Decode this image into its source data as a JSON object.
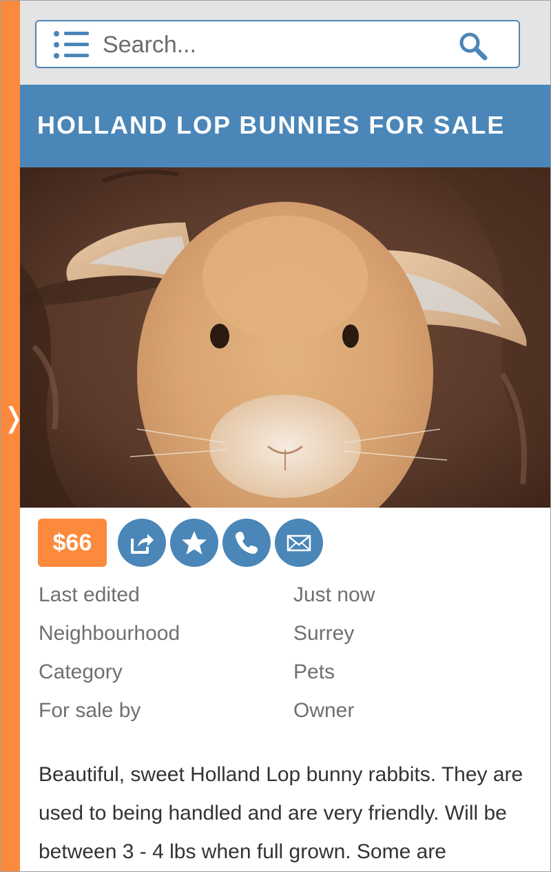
{
  "search": {
    "placeholder": "Search..."
  },
  "listing": {
    "title": "HOLLAND LOP BUNNIES FOR SALE",
    "price": "$66",
    "details": [
      {
        "label": "Last edited",
        "value": "Just now"
      },
      {
        "label": "Neighbourhood",
        "value": "Surrey"
      },
      {
        "label": "Category",
        "value": "Pets"
      },
      {
        "label": "For sale by",
        "value": "Owner"
      }
    ],
    "description": "Beautiful, sweet Holland Lop bunny rabbits. They are used to being handled and are very friendly. Will be between 3 - 4 lbs when full grown. Some are"
  },
  "icons": {
    "side_toggle": "chevron-right-icon",
    "menu": "list-icon",
    "search": "search-icon",
    "share": "share-icon",
    "favorite": "star-icon",
    "call": "phone-icon",
    "email": "envelope-icon"
  },
  "colors": {
    "accent_orange": "#fc8a3c",
    "brand_blue": "#4a86b7",
    "header_gray": "#e4e4e4"
  }
}
